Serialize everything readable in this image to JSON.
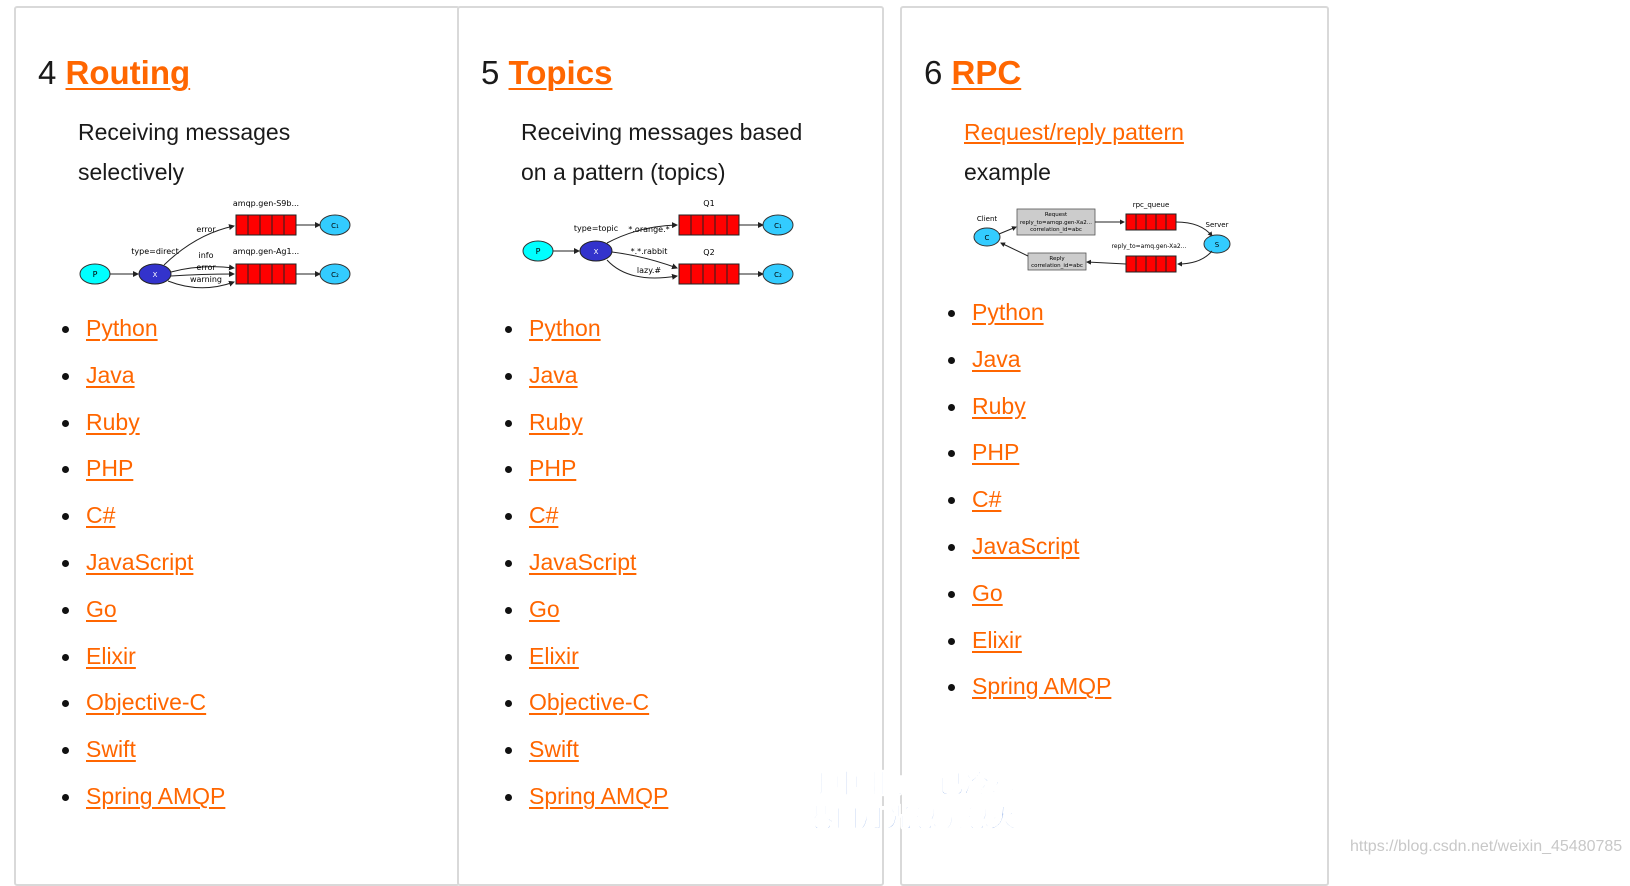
{
  "cards": [
    {
      "number": "4",
      "title": "Routing",
      "desc_line1": "Receiving messages",
      "desc_line2": "selectively",
      "diagram": {
        "producer": "P",
        "exchange": "X",
        "exchange_type": "type=direct",
        "queue1_name": "amqp.gen-S9b...",
        "queue2_name": "amqp.gen-Ag1...",
        "binding1": "error",
        "binding2a": "info",
        "binding2b": "error",
        "binding2c": "warning",
        "consumer1": "C₁",
        "consumer2": "C₂"
      },
      "languages": [
        "Python",
        "Java",
        "Ruby",
        "PHP",
        "C#",
        "JavaScript",
        "Go",
        "Elixir",
        "Objective-C",
        "Swift",
        "Spring AMQP"
      ]
    },
    {
      "number": "5",
      "title": "Topics",
      "desc_line1": "Receiving messages based",
      "desc_line2": "on a pattern (topics)",
      "diagram": {
        "producer": "P",
        "exchange": "X",
        "exchange_type": "type=topic",
        "queue1_name": "Q1",
        "queue2_name": "Q2",
        "binding1": "*.orange.*",
        "binding2a": "*.*.rabbit",
        "binding2b": "lazy.#",
        "consumer1": "C₁",
        "consumer2": "C₂"
      },
      "languages": [
        "Python",
        "Java",
        "Ruby",
        "PHP",
        "C#",
        "JavaScript",
        "Go",
        "Elixir",
        "Objective-C",
        "Swift",
        "Spring AMQP"
      ]
    },
    {
      "number": "6",
      "title": "RPC",
      "desc_link": "Request/reply pattern",
      "desc_line2": "example",
      "diagram": {
        "client_label": "Client",
        "client": "C",
        "server_label": "Server",
        "server": "S",
        "queue1_name": "rpc_queue",
        "queue2_name": "reply_to=amq.gen-Xa2...",
        "request_line1": "Request",
        "request_line2": "reply_to=amqp.gen-Xa2...",
        "request_line3": "correlation_id=abc",
        "reply_line1": "Reply",
        "reply_line2": "correlation_id=abc"
      },
      "languages": [
        "Python",
        "Java",
        "Ruby",
        "PHP",
        "C#",
        "JavaScript",
        "Go",
        "Elixir",
        "Spring AMQP"
      ]
    }
  ],
  "overlay": {
    "line1": "手中甜咖啡已冷却",
    "line2": "巷口灯光忽明忽灭"
  },
  "watermark": "https://blog.csdn.net/weixin_45480785",
  "colors": {
    "link": "#ff6600",
    "queue": "#ff0000",
    "exchange": "#3333cc",
    "node": "#33ccff",
    "producer": "#00ffff"
  }
}
